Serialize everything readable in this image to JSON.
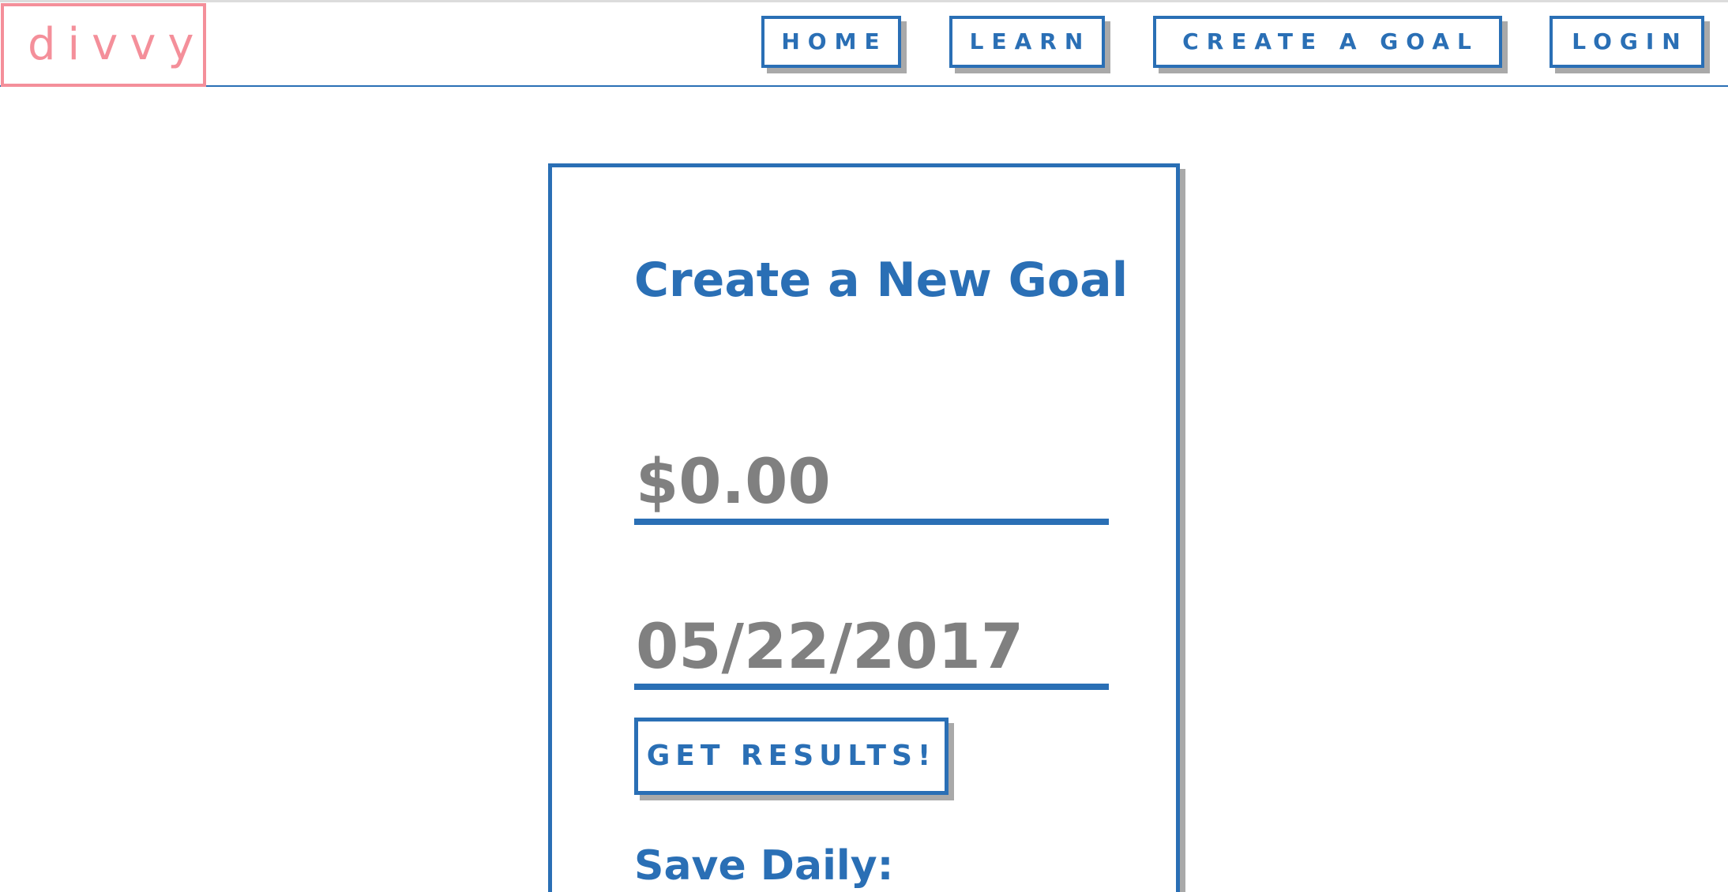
{
  "header": {
    "logo": "divvy",
    "nav": {
      "home": "HOME",
      "learn": "LEARN",
      "create_goal": "CREATE A GOAL",
      "login": "LOGIN"
    }
  },
  "goal_form": {
    "title": "Create a New Goal",
    "amount_placeholder": "$0.00",
    "date_placeholder": "05/22/2017",
    "submit_label": "GET RESULTS!",
    "save_daily_label": "Save Daily:"
  },
  "colors": {
    "primary": "#2a6fb5",
    "logo": "#f48f9a",
    "shadow": "#a9a9a9",
    "placeholder": "#808080"
  }
}
